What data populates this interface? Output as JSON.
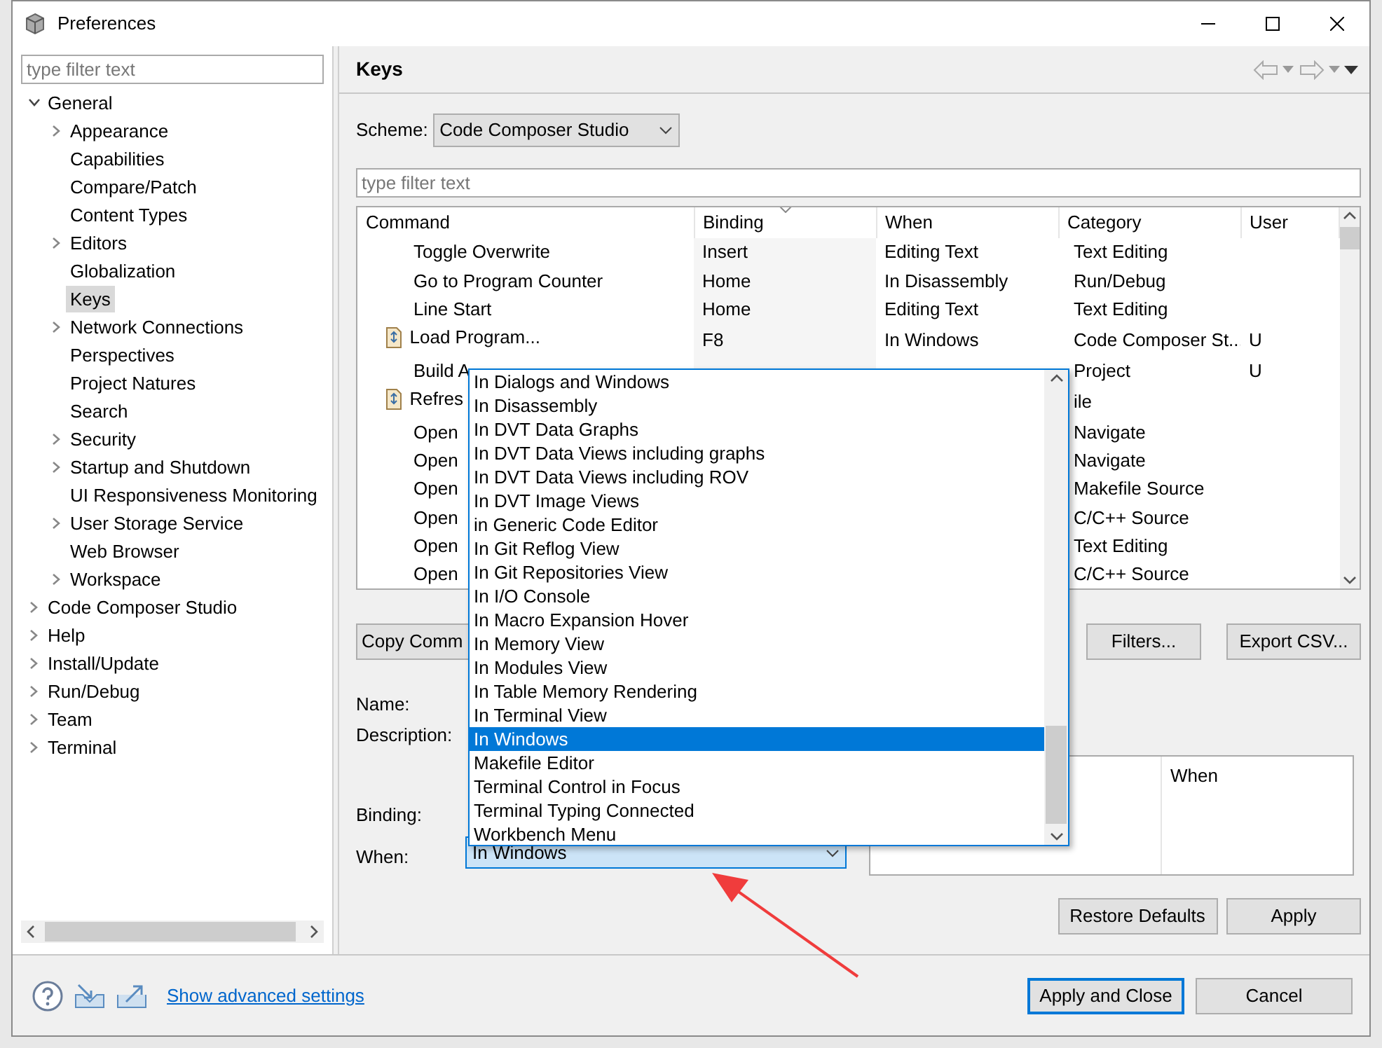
{
  "window": {
    "title": "Preferences"
  },
  "sidebar": {
    "filter_placeholder": "type filter text",
    "items": [
      {
        "label": "General",
        "expanded": true,
        "selected": false,
        "children": [
          {
            "label": "Appearance",
            "expanded": false,
            "selected": false
          },
          {
            "label": "Capabilities",
            "selected": false
          },
          {
            "label": "Compare/Patch",
            "selected": false
          },
          {
            "label": "Content Types",
            "selected": false
          },
          {
            "label": "Editors",
            "expanded": false,
            "selected": false
          },
          {
            "label": "Globalization",
            "selected": false
          },
          {
            "label": "Keys",
            "selected": true
          },
          {
            "label": "Network Connections",
            "expanded": false,
            "selected": false
          },
          {
            "label": "Perspectives",
            "selected": false
          },
          {
            "label": "Project Natures",
            "selected": false
          },
          {
            "label": "Search",
            "selected": false
          },
          {
            "label": "Security",
            "expanded": false,
            "selected": false
          },
          {
            "label": "Startup and Shutdown",
            "expanded": false,
            "selected": false
          },
          {
            "label": "UI Responsiveness Monitoring",
            "selected": false
          },
          {
            "label": "User Storage Service",
            "expanded": false,
            "selected": false
          },
          {
            "label": "Web Browser",
            "selected": false
          },
          {
            "label": "Workspace",
            "expanded": false,
            "selected": false
          }
        ]
      },
      {
        "label": "Code Composer Studio",
        "expanded": false,
        "selected": false
      },
      {
        "label": "Help",
        "expanded": false,
        "selected": false
      },
      {
        "label": "Install/Update",
        "expanded": false,
        "selected": false
      },
      {
        "label": "Run/Debug",
        "expanded": false,
        "selected": false
      },
      {
        "label": "Team",
        "expanded": false,
        "selected": false
      },
      {
        "label": "Terminal",
        "expanded": false,
        "selected": false
      }
    ]
  },
  "page": {
    "title": "Keys",
    "scheme_label": "Scheme:",
    "scheme_value": "Code Composer Studio",
    "filter_placeholder": "type filter text"
  },
  "commands_table": {
    "columns": [
      "Command",
      "Binding",
      "When",
      "Category",
      "User"
    ],
    "rows": [
      {
        "icon": false,
        "cells": [
          "Toggle Overwrite",
          "Insert",
          "Editing Text",
          "Text Editing",
          ""
        ]
      },
      {
        "icon": false,
        "cells": [
          "Go to Program Counter",
          "Home",
          "In Disassembly",
          "Run/Debug",
          ""
        ]
      },
      {
        "icon": false,
        "cells": [
          "Line Start",
          "Home",
          "Editing Text",
          "Text Editing",
          ""
        ]
      },
      {
        "icon": true,
        "cells": [
          "Load Program...",
          "F8",
          "In Windows",
          "Code Composer St...",
          "U"
        ]
      },
      {
        "icon": false,
        "cells": [
          "Build A",
          "",
          "",
          "Project",
          "U"
        ]
      },
      {
        "icon": true,
        "cells": [
          "Refres",
          "",
          "",
          "ile",
          ""
        ]
      },
      {
        "icon": false,
        "cells": [
          "Open",
          "",
          "",
          "Navigate",
          ""
        ]
      },
      {
        "icon": false,
        "cells": [
          "Open",
          "",
          "",
          "Navigate",
          ""
        ]
      },
      {
        "icon": false,
        "cells": [
          "Open",
          "",
          "",
          "Makefile Source",
          ""
        ]
      },
      {
        "icon": false,
        "cells": [
          "Open",
          "",
          "",
          "C/C++ Source",
          ""
        ]
      },
      {
        "icon": false,
        "cells": [
          "Open",
          "",
          "",
          "Text Editing",
          ""
        ]
      },
      {
        "icon": false,
        "cells": [
          "Open",
          "",
          "",
          "C/C++ Source",
          ""
        ]
      }
    ]
  },
  "table_buttons": [
    "Copy Comm",
    "Filters...",
    "Export CSV..."
  ],
  "details": {
    "name_label": "Name:",
    "description_label": "Description:",
    "binding_label": "Binding:",
    "when_label": "When:",
    "when_value": "In Windows"
  },
  "conflicts_table": {
    "columns": [
      "",
      "When"
    ]
  },
  "when_dropdown": {
    "options": [
      {
        "label": "In Dialogs and Windows",
        "selected": false
      },
      {
        "label": "In Disassembly",
        "selected": false
      },
      {
        "label": "In DVT Data Graphs",
        "selected": false
      },
      {
        "label": "In DVT Data Views including graphs",
        "selected": false
      },
      {
        "label": "In DVT Data Views including ROV",
        "selected": false
      },
      {
        "label": "In DVT Image Views",
        "selected": false
      },
      {
        "label": "in Generic Code Editor",
        "selected": false
      },
      {
        "label": "In Git Reflog View",
        "selected": false
      },
      {
        "label": "In Git Repositories View",
        "selected": false
      },
      {
        "label": "In I/O Console",
        "selected": false
      },
      {
        "label": "In Macro Expansion Hover",
        "selected": false
      },
      {
        "label": "In Memory View",
        "selected": false
      },
      {
        "label": "In Modules View",
        "selected": false
      },
      {
        "label": "In Table Memory Rendering",
        "selected": false
      },
      {
        "label": "In Terminal View",
        "selected": false
      },
      {
        "label": "In Windows",
        "selected": true
      },
      {
        "label": "Makefile Editor",
        "selected": false
      },
      {
        "label": "Terminal Control in Focus",
        "selected": false
      },
      {
        "label": "Terminal Typing Connected",
        "selected": false
      },
      {
        "label": "Workbench Menu",
        "selected": false
      }
    ]
  },
  "page_buttons": [
    "Restore Defaults",
    "Apply"
  ],
  "footer": {
    "link": "Show advanced settings",
    "buttons": [
      {
        "label": "Apply and Close",
        "default": true
      },
      {
        "label": "Cancel",
        "default": false
      }
    ]
  }
}
